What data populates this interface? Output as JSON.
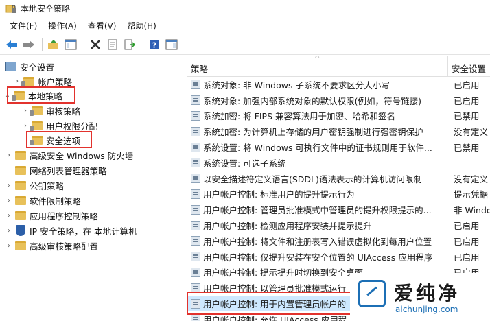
{
  "window": {
    "title": "本地安全策略"
  },
  "menu": [
    "文件(F)",
    "操作(A)",
    "查看(V)",
    "帮助(H)"
  ],
  "tree": [
    {
      "label": "安全设置",
      "icon": "computer-icon",
      "indent": 0,
      "chevron": ""
    },
    {
      "label": "帐户策略",
      "icon": "folder-lock-icon",
      "indent": 1,
      "chevron": ">"
    },
    {
      "label": "本地策略",
      "icon": "folder-lock-icon",
      "indent": 1,
      "chevron": "v"
    },
    {
      "label": "审核策略",
      "icon": "folder-lock-icon",
      "indent": 2,
      "chevron": ">"
    },
    {
      "label": "用户权限分配",
      "icon": "folder-lock-icon",
      "indent": 2,
      "chevron": ">"
    },
    {
      "label": "安全选项",
      "icon": "folder-lock-icon",
      "indent": 2,
      "chevron": ""
    },
    {
      "label": "高级安全 Windows 防火墙",
      "icon": "folder-icon",
      "indent": 1,
      "chevron": ">"
    },
    {
      "label": "网络列表管理器策略",
      "icon": "folder-icon",
      "indent": 1,
      "chevron": ""
    },
    {
      "label": "公钥策略",
      "icon": "folder-icon",
      "indent": 1,
      "chevron": ">"
    },
    {
      "label": "软件限制策略",
      "icon": "folder-icon",
      "indent": 1,
      "chevron": ">"
    },
    {
      "label": "应用程序控制策略",
      "icon": "folder-icon",
      "indent": 1,
      "chevron": ">"
    },
    {
      "label": "IP 安全策略，在 本地计算机",
      "icon": "shield-icon",
      "indent": 1,
      "chevron": ">"
    },
    {
      "label": "高级审核策略配置",
      "icon": "folder-icon",
      "indent": 1,
      "chevron": ">"
    }
  ],
  "list": {
    "col_policy": "策略",
    "col_setting": "安全设置",
    "rows": [
      {
        "policy": "系统对象: 非 Windows 子系统不要求区分大小写",
        "setting": "已启用"
      },
      {
        "policy": "系统对象: 加强内部系统对象的默认权限(例如，符号链接)",
        "setting": "已启用"
      },
      {
        "policy": "系统加密: 将 FIPS 兼容算法用于加密、哈希和签名",
        "setting": "已禁用"
      },
      {
        "policy": "系统加密: 为计算机上存储的用户密钥强制进行强密钥保护",
        "setting": "没有定义"
      },
      {
        "policy": "系统设置: 将 Windows 可执行文件中的证书规则用于软件...",
        "setting": "已禁用"
      },
      {
        "policy": "系统设置: 可选子系统",
        "setting": ""
      },
      {
        "policy": "以安全描述符定义语言(SDDL)语法表示的计算机访问限制",
        "setting": "没有定义"
      },
      {
        "policy": "用户帐户控制: 标准用户的提升提示行为",
        "setting": "提示凭据"
      },
      {
        "policy": "用户帐户控制: 管理员批准模式中管理员的提升权限提示的...",
        "setting": "非 Windows"
      },
      {
        "policy": "用户帐户控制: 检测应用程序安装并提示提升",
        "setting": "已启用"
      },
      {
        "policy": "用户帐户控制: 将文件和注册表写入错误虚拟化到每用户位置",
        "setting": "已启用"
      },
      {
        "policy": "用户帐户控制: 仅提升安装在安全位置的 UIAccess 应用程序",
        "setting": "已启用"
      },
      {
        "policy": "用户帐户控制: 提示提升时切换到安全桌面",
        "setting": "已启用"
      },
      {
        "policy": "用户帐户控制: 以管理员批准模式运行",
        "setting": ""
      },
      {
        "policy": "用户帐户控制: 用于内置管理员帐户的",
        "setting": ""
      },
      {
        "policy": "用户帐户控制: 允许 UIAccess 应用程",
        "setting": ""
      }
    ]
  },
  "watermark": {
    "brand": "爱纯净",
    "url": "aichunjing.com"
  }
}
